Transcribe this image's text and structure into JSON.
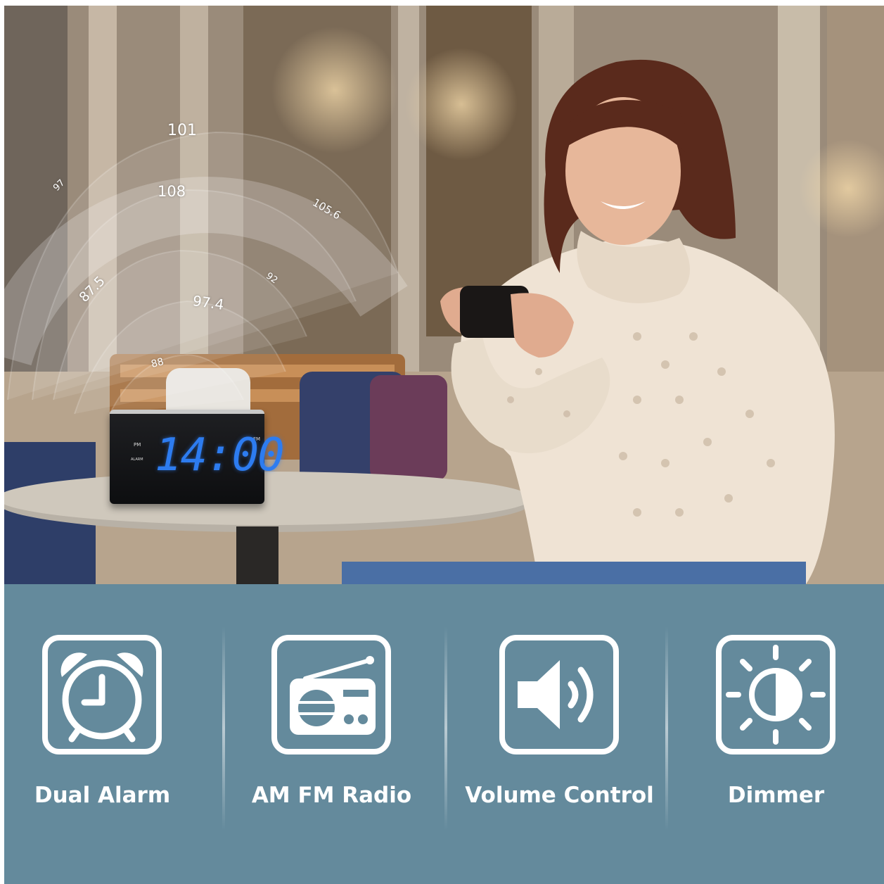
{
  "radio_frequencies": [
    {
      "label": "101"
    },
    {
      "label": "97"
    },
    {
      "label": "108"
    },
    {
      "label": "105.6"
    },
    {
      "label": "87.5"
    },
    {
      "label": "92"
    },
    {
      "label": "97.4"
    },
    {
      "label": "88"
    }
  ],
  "clock": {
    "time": "14:00",
    "band_left": "PM",
    "band_right": "FM",
    "alarm_label": "ALARM"
  },
  "features": [
    {
      "label": "Dual Alarm",
      "icon": "alarm-clock-icon"
    },
    {
      "label": "AM FM Radio",
      "icon": "radio-icon"
    },
    {
      "label": "Volume Control",
      "icon": "speaker-volume-icon"
    },
    {
      "label": "Dimmer",
      "icon": "brightness-icon"
    }
  ],
  "colors": {
    "panel": "#648a9c",
    "icon_stroke": "#ffffff",
    "clock_digits": "#2d7cf0"
  }
}
